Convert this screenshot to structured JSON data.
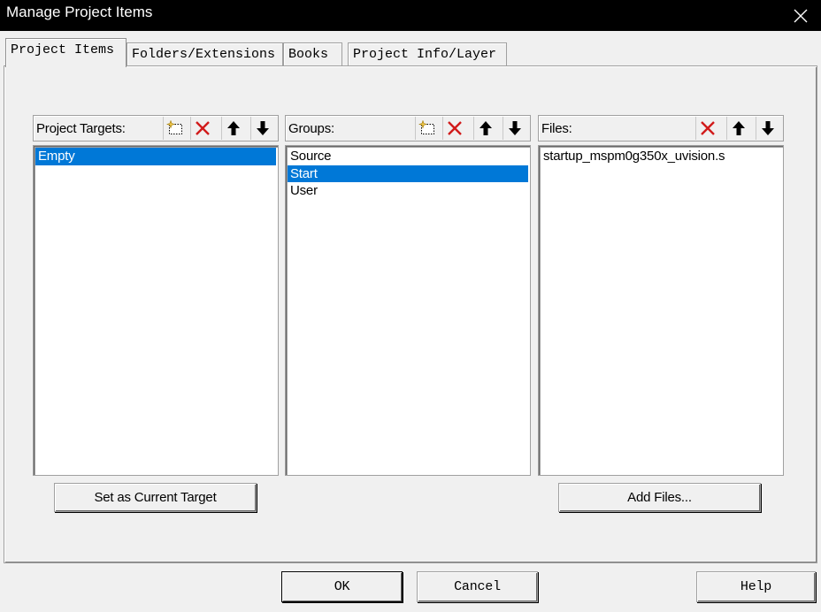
{
  "window": {
    "title": "Manage Project Items"
  },
  "tabs": [
    {
      "label": "Project Items",
      "active": true
    },
    {
      "label": "Folders/Extensions",
      "active": false
    },
    {
      "label": "Books",
      "active": false
    },
    {
      "label": "Project Info/Layer",
      "active": false
    }
  ],
  "targets": {
    "label": "Project Targets:",
    "items": [
      {
        "label": "Empty",
        "selected": true
      }
    ],
    "button": "Set as Current Target"
  },
  "groups": {
    "label": "Groups:",
    "items": [
      {
        "label": "Source",
        "selected": false
      },
      {
        "label": "Start",
        "selected": true
      },
      {
        "label": "User",
        "selected": false
      }
    ]
  },
  "files": {
    "label": "Files:",
    "items": [
      {
        "label": "startup_mspm0g350x_uvision.s",
        "selected": false
      }
    ],
    "button": "Add Files..."
  },
  "footer": {
    "ok": "OK",
    "cancel": "Cancel",
    "help": "Help"
  },
  "colors": {
    "selection": "#0078d7",
    "delete_icon": "#d11b1b",
    "new_icon": "#f2c94c"
  },
  "icons": [
    "new-item-icon",
    "delete-icon",
    "move-up-icon",
    "move-down-icon",
    "close-icon"
  ]
}
